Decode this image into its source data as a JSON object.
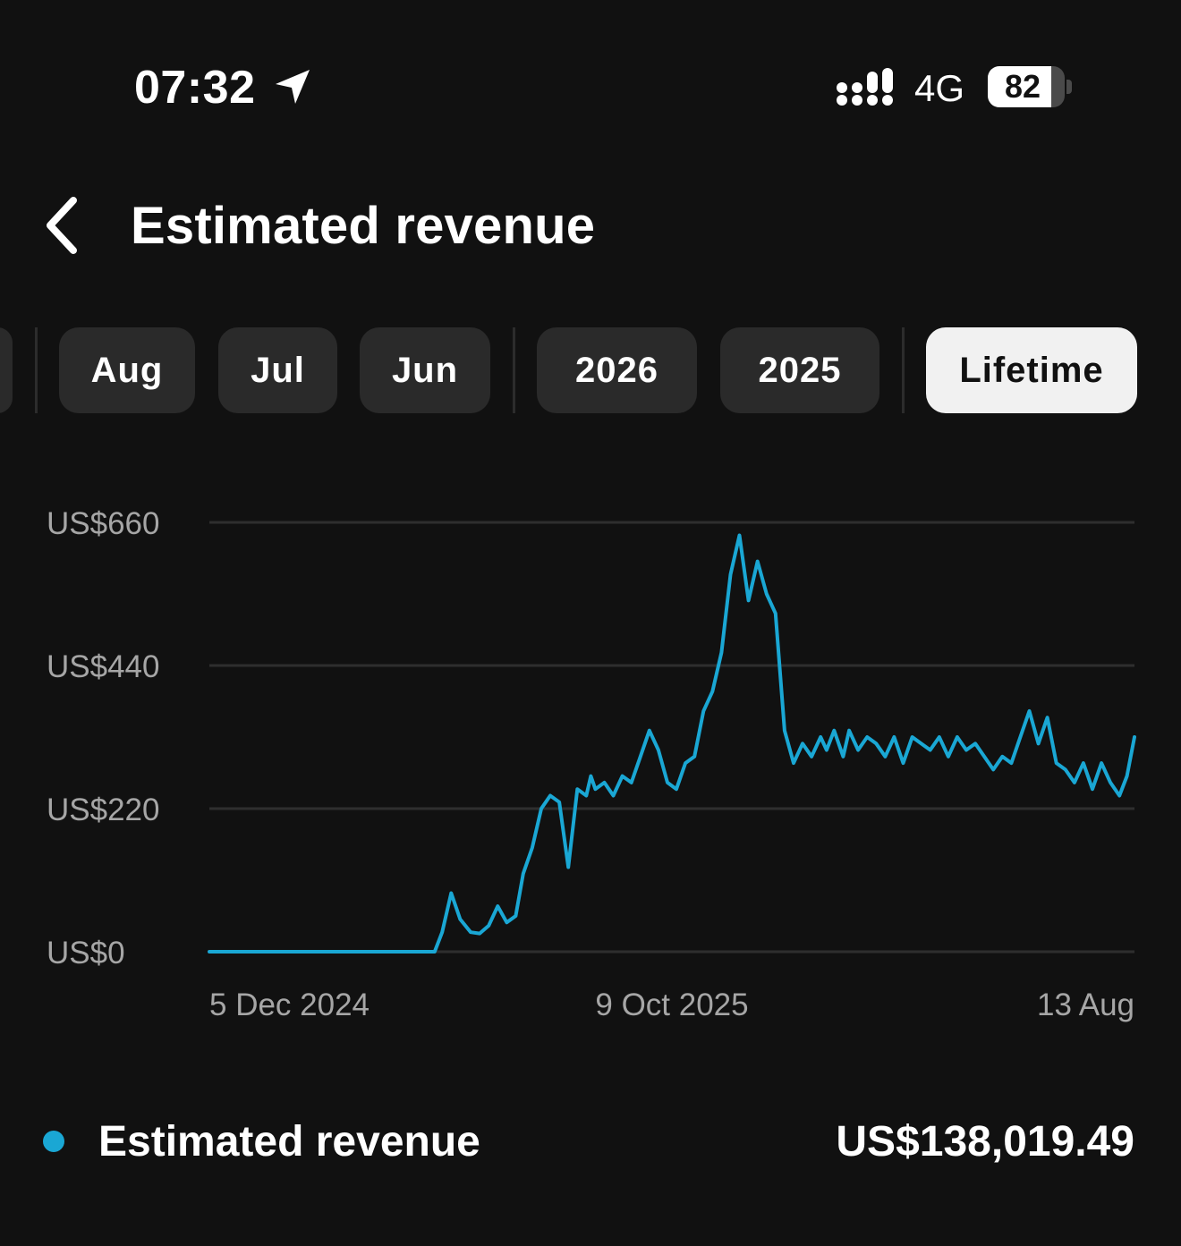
{
  "status_bar": {
    "time": "07:32",
    "network": "4G",
    "battery_percent": "82",
    "battery_level": 0.82,
    "location_icon": "location-arrow-icon",
    "signal_icon": "signal-bars-icon"
  },
  "header": {
    "back_icon": "chevron-left-icon",
    "title": "Estimated revenue"
  },
  "filters": {
    "items": [
      {
        "label": "Aug",
        "selected": false
      },
      {
        "label": "Jul",
        "selected": false
      },
      {
        "label": "Jun",
        "selected": false
      },
      {
        "label": "2026",
        "selected": false
      },
      {
        "label": "2025",
        "selected": false
      },
      {
        "label": "Lifetime",
        "selected": true
      }
    ]
  },
  "colors": {
    "background": "#111111",
    "accent": "#1aa7d4",
    "chip": "#2a2a2a",
    "chip_selected": "#f1f1f1",
    "grid": "#2e2e2e",
    "axis_text": "#a6a6a6"
  },
  "chart_data": {
    "type": "line",
    "y_tick_labels": [
      "US$0",
      "US$220",
      "US$440",
      "US$660"
    ],
    "y_ticks": [
      0,
      220,
      440,
      660
    ],
    "ylim": [
      0,
      660
    ],
    "x_tick_labels": [
      "5 Dec 2024",
      "9 Oct 2025",
      "13 Aug"
    ],
    "x_ticks": [
      "2024-12-05",
      "2025-10-09",
      "2026-08-13"
    ],
    "xlim": [
      "2024-12-05",
      "2026-08-13"
    ],
    "grid": true,
    "series": [
      {
        "name": "Estimated revenue",
        "color": "#1aa7d4",
        "x": [
          "2024-12-05",
          "2025-01-04",
          "2025-02-03",
          "2025-03-05",
          "2025-04-04",
          "2025-05-04",
          "2025-05-09",
          "2025-05-15",
          "2025-05-21",
          "2025-05-28",
          "2025-06-03",
          "2025-06-09",
          "2025-06-15",
          "2025-06-21",
          "2025-06-27",
          "2025-07-02",
          "2025-07-08",
          "2025-07-14",
          "2025-07-20",
          "2025-07-26",
          "2025-08-01",
          "2025-08-07",
          "2025-08-13",
          "2025-08-16",
          "2025-08-19",
          "2025-08-25",
          "2025-08-31",
          "2025-09-06",
          "2025-09-12",
          "2025-09-18",
          "2025-09-24",
          "2025-09-30",
          "2025-10-06",
          "2025-10-12",
          "2025-10-18",
          "2025-10-24",
          "2025-10-30",
          "2025-11-05",
          "2025-11-11",
          "2025-11-17",
          "2025-11-23",
          "2025-11-29",
          "2025-12-05",
          "2025-12-11",
          "2025-12-17",
          "2025-12-23",
          "2025-12-29",
          "2026-01-04",
          "2026-01-10",
          "2026-01-16",
          "2026-01-20",
          "2026-01-25",
          "2026-01-31",
          "2026-02-04",
          "2026-02-10",
          "2026-02-16",
          "2026-02-22",
          "2026-02-28",
          "2026-03-06",
          "2026-03-12",
          "2026-03-18",
          "2026-03-24",
          "2026-03-30",
          "2026-04-05",
          "2026-04-11",
          "2026-04-17",
          "2026-04-23",
          "2026-04-29",
          "2026-05-05",
          "2026-05-11",
          "2026-05-17",
          "2026-05-23",
          "2026-05-29",
          "2026-06-04",
          "2026-06-10",
          "2026-06-16",
          "2026-06-22",
          "2026-06-28",
          "2026-07-04",
          "2026-07-10",
          "2026-07-16",
          "2026-07-22",
          "2026-07-28",
          "2026-08-03",
          "2026-08-08",
          "2026-08-13"
        ],
        "values": [
          0,
          0,
          0,
          0,
          0,
          0,
          30,
          90,
          50,
          30,
          28,
          40,
          70,
          45,
          55,
          120,
          160,
          220,
          240,
          230,
          130,
          250,
          240,
          270,
          250,
          260,
          240,
          270,
          260,
          300,
          340,
          310,
          260,
          250,
          290,
          300,
          370,
          400,
          460,
          580,
          640,
          540,
          600,
          550,
          520,
          340,
          290,
          320,
          300,
          330,
          310,
          340,
          300,
          340,
          310,
          330,
          320,
          300,
          330,
          290,
          330,
          320,
          310,
          330,
          300,
          330,
          310,
          320,
          300,
          280,
          300,
          290,
          330,
          370,
          320,
          360,
          290,
          280,
          260,
          290,
          250,
          290,
          260,
          240,
          270,
          330
        ]
      }
    ]
  },
  "legend": {
    "label": "Estimated revenue",
    "total": "US$138,019.49"
  }
}
